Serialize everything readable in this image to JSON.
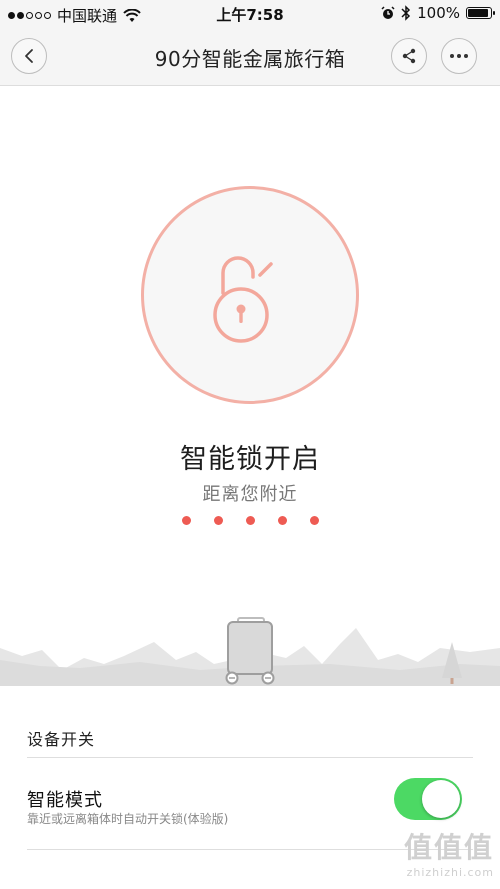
{
  "status_bar": {
    "carrier": "中国联通",
    "time": "上午7:58",
    "battery": "100%",
    "battery_level": 1.0
  },
  "nav": {
    "title": "90分智能金属旅行箱"
  },
  "lock": {
    "status_title": "智能锁开启",
    "status_subtitle": "距离您附近",
    "accent_color": "#f3b0a6",
    "dot_color": "#ee5b53",
    "dot_count": 5
  },
  "settings": {
    "section_title": "设备开关",
    "smart_mode": {
      "name": "智能模式",
      "description": "靠近或远离箱体时自动开关锁(体验版)",
      "enabled": true,
      "toggle_color": "#4cd964"
    }
  },
  "watermark": {
    "big": "值值值",
    "small": "zhizhizhi.com"
  }
}
